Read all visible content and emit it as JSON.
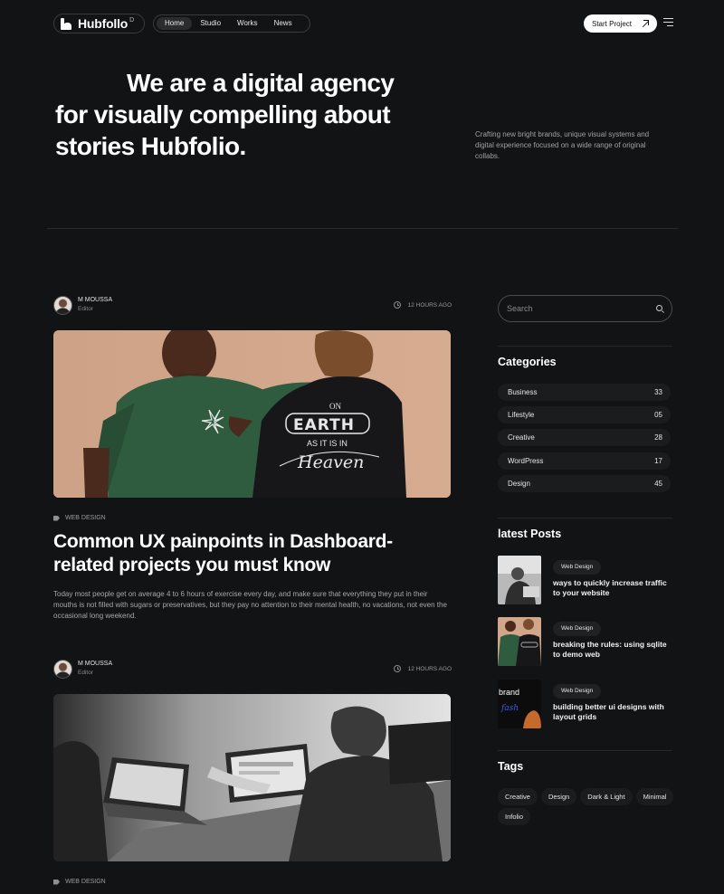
{
  "header": {
    "logo_text": "Hubfollo",
    "logo_sup": "D",
    "nav": [
      "Home",
      "Studio",
      "Works",
      "News"
    ],
    "cta_label": "Start Project"
  },
  "hero": {
    "title_lines": [
      "We are a digital agency",
      "for visually compelling about",
      "stories Hubfolio."
    ],
    "description": "Crafting new bright brands, unique visual systems and digital experience focused on a wide range of original collabs."
  },
  "posts": [
    {
      "author": "M MOUSSA",
      "role": "Editor",
      "time": "12 HOURS AGO",
      "category": "WEB DESIGN",
      "title": "Common UX painpoints in Dashboard-related projects you must know",
      "excerpt": "Today most people get on average 4 to 6 hours of exercise every day, and make sure that everything they put in their mouths is not filled with sugars or preservatives, but they pay no attention to their mental health, no vacations, not even the occasional long weekend.",
      "image_text": {
        "on": "ON",
        "earth": "EARTH",
        "as_it_is_in": "AS IT IS IN",
        "heaven": "Heaven"
      }
    },
    {
      "author": "M MOUSSA",
      "role": "Editor",
      "time": "12 HOURS AGO",
      "category": "WEB DESIGN"
    }
  ],
  "sidebar": {
    "search_placeholder": "Search",
    "categories_heading": "Categories",
    "categories": [
      {
        "name": "Business",
        "count": "33"
      },
      {
        "name": "Lifestyle",
        "count": "05"
      },
      {
        "name": "Creative",
        "count": "28"
      },
      {
        "name": "WordPress",
        "count": "17"
      },
      {
        "name": "Design",
        "count": "45"
      }
    ],
    "latest_heading": "latest Posts",
    "latest_posts": [
      {
        "tag": "Web Design",
        "title": "ways to quickly increase traffic to your website"
      },
      {
        "tag": "Web Design",
        "title": "breaking the rules: using sqlite to demo web"
      },
      {
        "tag": "Web Design",
        "title": "building better ui designs with layout grids",
        "thumb_text_1": "brand",
        "thumb_text_2": "fash"
      }
    ],
    "tags_heading": "Tags",
    "tags": [
      "Creative",
      "Design",
      "Dark & Light",
      "Minimal",
      "Infolio"
    ]
  }
}
